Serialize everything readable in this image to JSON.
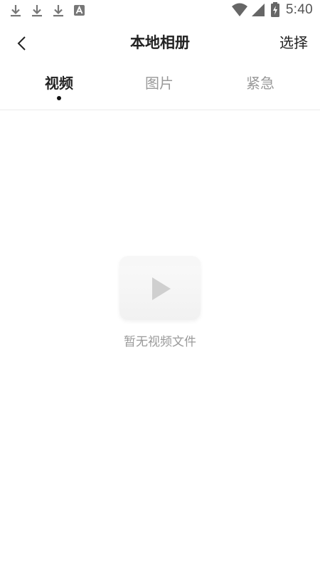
{
  "status_bar": {
    "time": "5:40",
    "left_icons": [
      "download-icon",
      "download-icon",
      "download-icon",
      "app-notification-icon"
    ],
    "right_icons": [
      "wifi-icon",
      "cell-signal-icon",
      "battery-charging-icon"
    ]
  },
  "header": {
    "back_icon": "chevron-left-icon",
    "title": "本地相册",
    "select_label": "选择"
  },
  "tabs": [
    {
      "label": "视频",
      "active": true
    },
    {
      "label": "图片",
      "active": false
    },
    {
      "label": "紧急",
      "active": false
    }
  ],
  "empty_state": {
    "icon": "video-play-icon",
    "text": "暂无视频文件"
  },
  "colors": {
    "text_primary": "#222222",
    "text_inactive": "#999999",
    "empty_text": "#9a9a9a",
    "divider": "#ececec"
  }
}
